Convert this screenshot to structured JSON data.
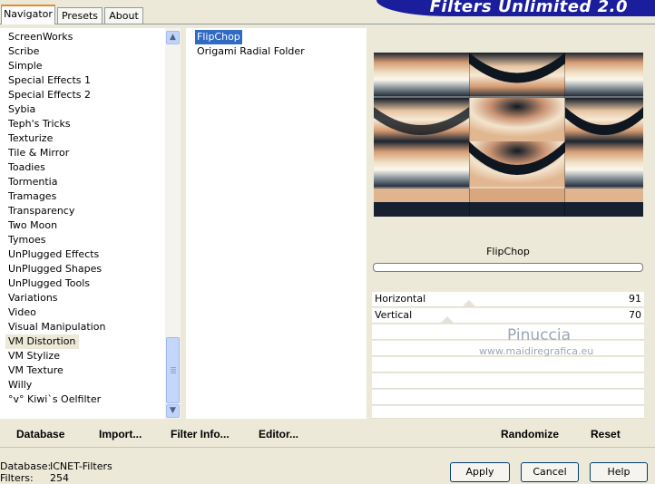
{
  "header": {
    "title": "Filters Unlimited 2.0"
  },
  "tabs": [
    {
      "label": "Navigator",
      "active": true
    },
    {
      "label": "Presets",
      "active": false
    },
    {
      "label": "About",
      "active": false
    }
  ],
  "categories": {
    "items": [
      "ScreenWorks",
      "Scribe",
      "Simple",
      "Special Effects 1",
      "Special Effects 2",
      "Sybia",
      "Teph's Tricks",
      "Texturize",
      "Tile & Mirror",
      "Toadies",
      "Tormentia",
      "Tramages",
      "Transparency",
      "Two Moon",
      "Tymoes",
      "UnPlugged Effects",
      "UnPlugged Shapes",
      "UnPlugged Tools",
      "Variations",
      "Video",
      "Visual Manipulation",
      "VM Distortion",
      "VM Stylize",
      "VM Texture",
      "Willy",
      "°v° Kiwi`s Oelfilter"
    ],
    "selected": "VM Distortion"
  },
  "filters": {
    "items": [
      "FlipChop",
      "Origami Radial Folder"
    ],
    "selected": "FlipChop"
  },
  "toolbar": {
    "database": "Database",
    "import": "Import...",
    "filter_info": "Filter Info...",
    "editor": "Editor...",
    "randomize": "Randomize",
    "reset": "Reset"
  },
  "filter_title": "FlipChop",
  "sliders": [
    {
      "label": "Horizontal",
      "value": "91"
    },
    {
      "label": "Vertical",
      "value": "70"
    }
  ],
  "watermark": {
    "line1": "Pinuccia",
    "line2": "www.maidiregrafica.eu"
  },
  "status": {
    "database_label": "Database:",
    "database_value": "ICNET-Filters",
    "filters_label": "Filters:",
    "filters_value": "254"
  },
  "buttons": {
    "apply": "Apply",
    "cancel": "Cancel",
    "help": "Help"
  },
  "colors": {
    "banner": "#1a1d9c",
    "selection": "#316ac5",
    "tab_accent": "#e68b2c"
  },
  "icons": {
    "scroll_up": "arrow-up-icon",
    "scroll_down": "arrow-down-icon"
  }
}
